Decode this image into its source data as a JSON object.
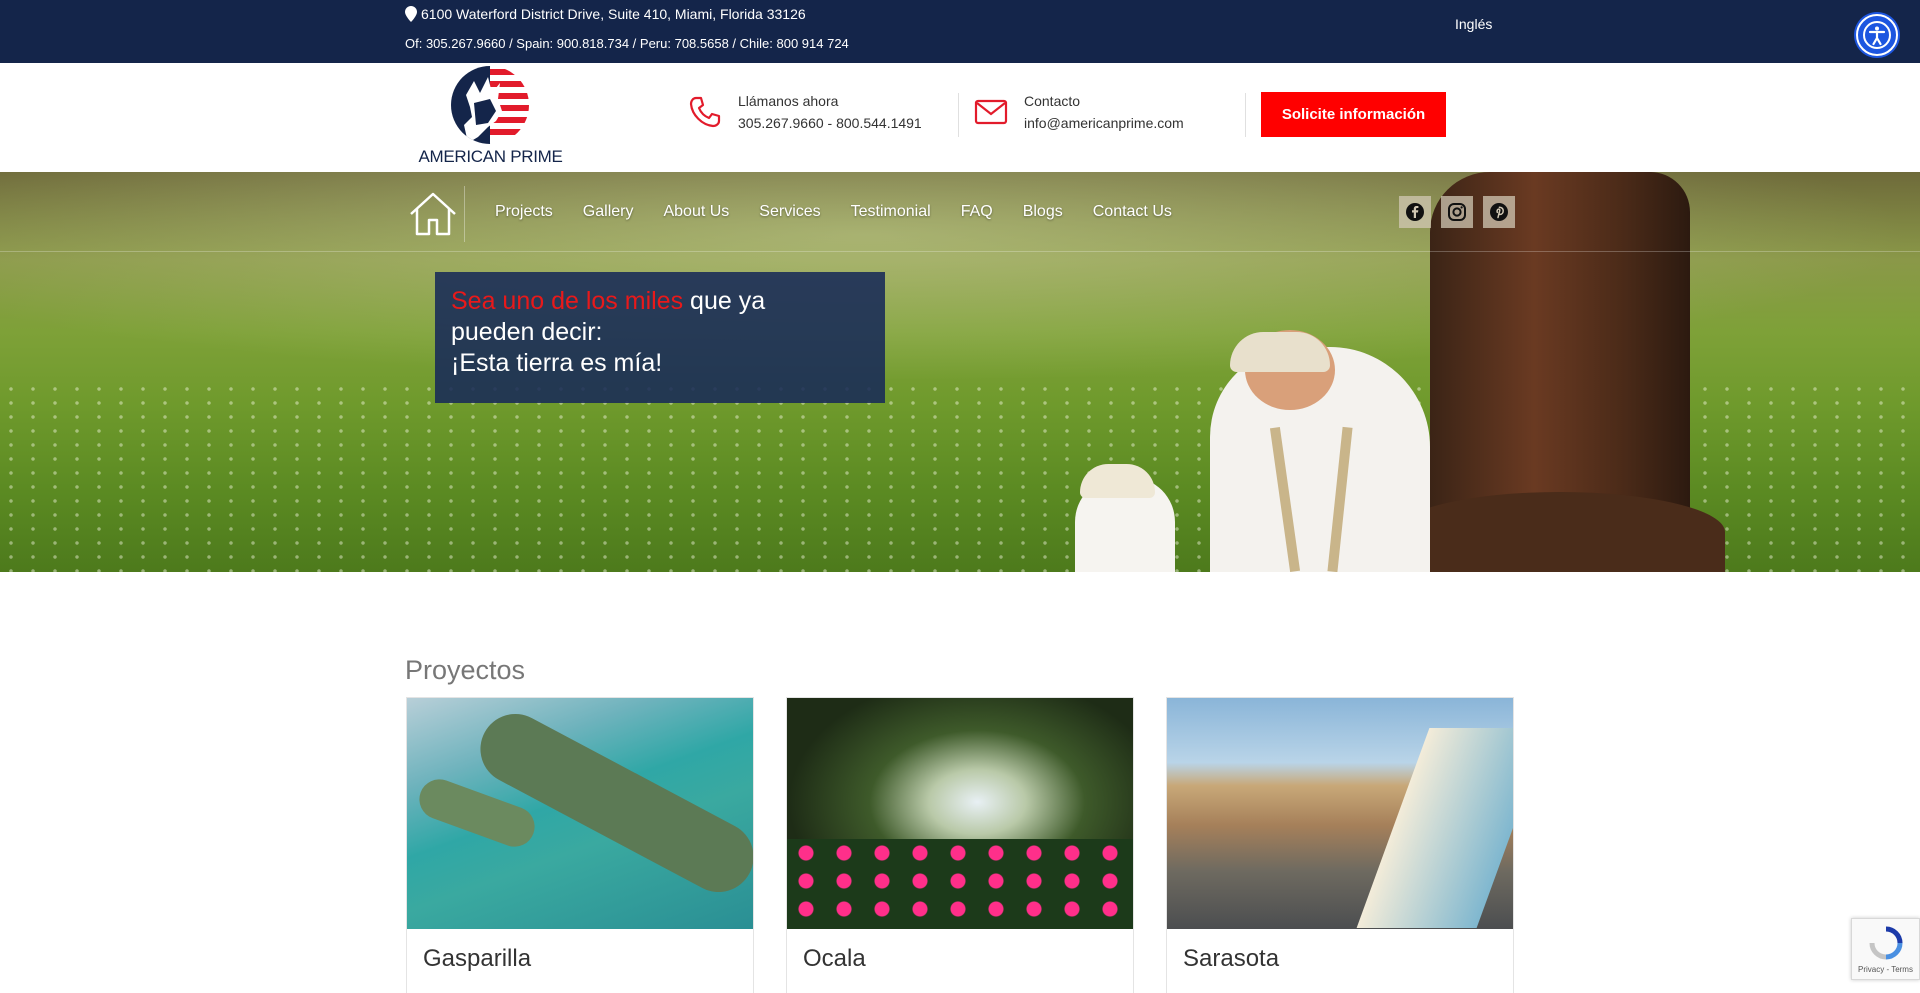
{
  "topbar": {
    "address": "6100 Waterford District Drive, Suite 410, Miami, Florida 33126",
    "phones": "Of: 305.267.9660 / Spain: 900.818.734 / Peru: 708.5658 / Chile: 800 914 724",
    "language": "Inglés"
  },
  "header": {
    "logo_text": "AMERICAN PRIME",
    "call_label": "Llámanos ahora",
    "call_value": "305.267.9660 - 800.544.1491",
    "contact_label": "Contacto",
    "contact_value": "info@americanprime.com",
    "cta_label": "Solicite información"
  },
  "nav": {
    "items": [
      "Projects",
      "Gallery",
      "About Us",
      "Services",
      "Testimonial",
      "FAQ",
      "Blogs",
      "Contact Us"
    ]
  },
  "hero": {
    "highlight": "Sea uno de los miles",
    "line1_rest": " que ya",
    "line2": "pueden decir:",
    "line3": "¡Esta tierra es mía!"
  },
  "projects": {
    "title": "Proyectos",
    "cards": [
      {
        "name": "Gasparilla"
      },
      {
        "name": "Ocala"
      },
      {
        "name": "Sarasota"
      }
    ]
  },
  "recaptcha": {
    "text": "Privacy - Terms"
  },
  "colors": {
    "navy": "#14254a",
    "red": "#ff0000",
    "accessibility": "#1d56e0"
  }
}
